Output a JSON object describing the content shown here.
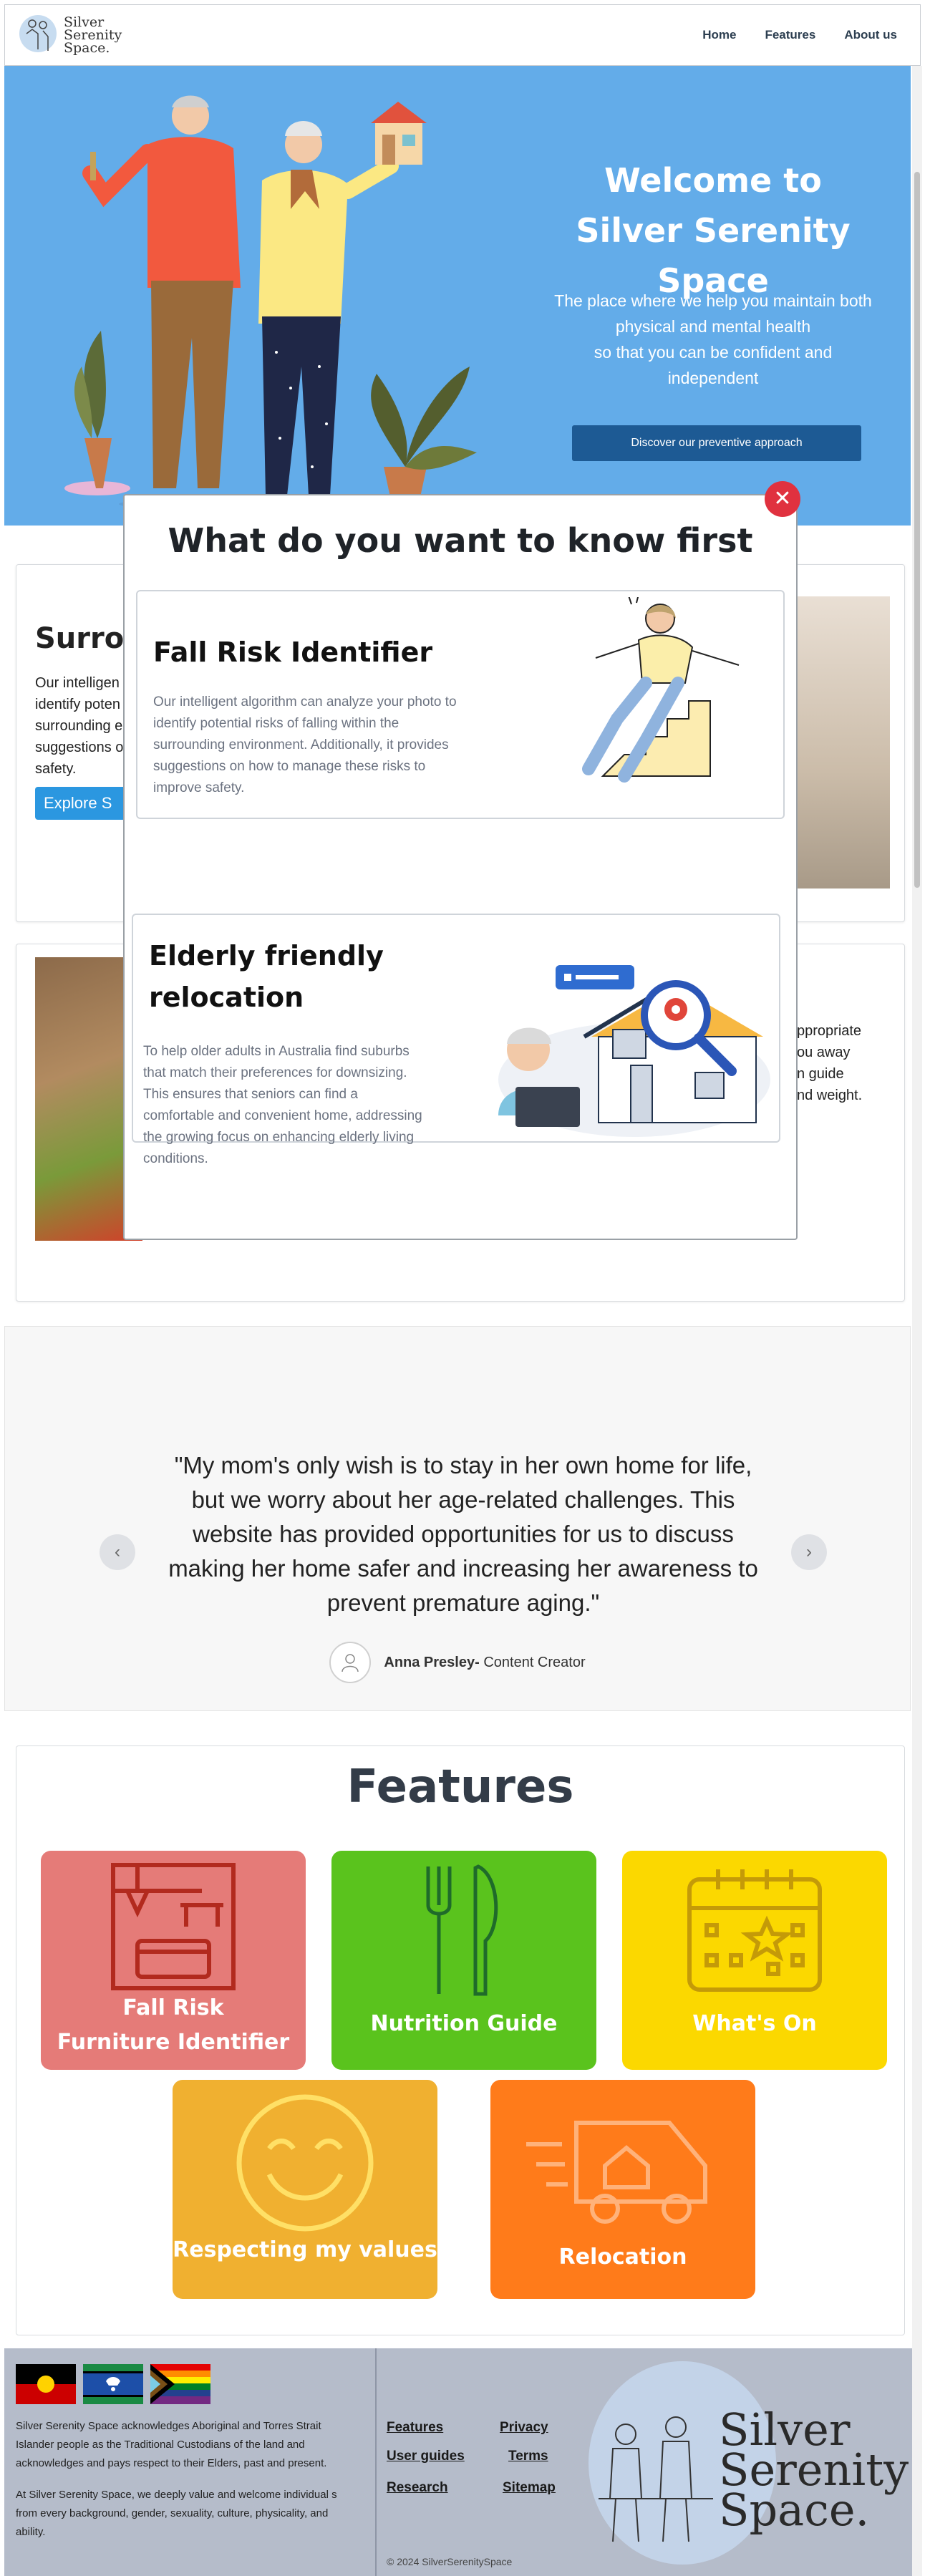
{
  "header": {
    "logo_text_1": "Silver",
    "logo_text_2": "Serenity",
    "logo_text_3": "Space.",
    "nav": [
      "Home",
      "Features",
      "About us"
    ]
  },
  "hero": {
    "title_line1": "Welcome to",
    "title_line2": "Silver Serenity Space",
    "subtitle_line1": "The place where we help you maintain both",
    "subtitle_line2": "physical and mental health",
    "subtitle_line3": "so that you can be confident and",
    "subtitle_line4": "independent",
    "button": "Discover our preventive approach",
    "bg_color": "#63ace9"
  },
  "background_sections": {
    "s1_title": "Surrou",
    "s1_text": [
      "Our intelligen",
      "identify poten",
      "surrounding e",
      "suggestions o",
      "safety."
    ],
    "s1_button": "Explore S",
    "s2_text": [
      "ppropriate",
      "ou away",
      "n guide",
      "nd weight."
    ]
  },
  "modal": {
    "title": "What do you want to know first",
    "close": "✕",
    "option1": {
      "title": "Fall Risk Identifier",
      "desc": [
        "Our intelligent algorithm can analyze your photo to",
        "identify potential risks of falling within the",
        "surrounding environment. Additionally, it provides",
        "suggestions on how to manage these risks to",
        "improve safety."
      ]
    },
    "option2": {
      "title_line1": "Elderly friendly",
      "title_line2": "relocation",
      "desc": [
        "To help older adults in Australia find suburbs",
        "that match their preferences for downsizing.",
        "This ensures that seniors can find a",
        "comfortable and convenient home, addressing",
        "the growing focus on enhancing elderly living",
        "conditions."
      ]
    }
  },
  "testimonial": {
    "quote": [
      "\"My mom's only wish is to stay in her own home for life,",
      "but we worry about her age-related challenges. This",
      "website has provided opportunities for us to discuss",
      "making her home safer and increasing her awareness to",
      "prevent premature aging.\""
    ],
    "author_name": "Anna Presley-",
    "author_role": " Content Creator",
    "prev": "‹",
    "next": "›"
  },
  "features": {
    "title": "Features",
    "tiles": [
      {
        "label_line1": "Fall Risk",
        "label_line2": "Furniture Identifier",
        "color": "#e57b78",
        "icon": "furniture-icon"
      },
      {
        "label_line1": "Nutrition Guide",
        "color": "#5ac31d",
        "icon": "cutlery-icon"
      },
      {
        "label_line1": "What's On",
        "color": "#fbd800",
        "icon": "calendar-icon"
      },
      {
        "label_line1": "Respecting my values",
        "color": "#f0b030",
        "icon": "smiley-icon"
      },
      {
        "label_line1": "Relocation",
        "color": "#ff7b1a",
        "icon": "moving-truck-icon"
      }
    ]
  },
  "footer": {
    "ack1": [
      "Silver Serenity Space acknowledges Aboriginal and Torres Strait",
      "Islander people as the Traditional Custodians of the land  and",
      "acknowledges and pays respect to their Elders, past and present."
    ],
    "ack2": [
      "At Silver Serenity Space, we deeply value and welcome individual s",
      "from every background, gender, sexuality, culture, physicality, and",
      "ability."
    ],
    "links_col1": [
      "Features",
      "User guides",
      "Research"
    ],
    "links_col2": [
      "Privacy",
      "Terms",
      "Sitemap"
    ],
    "copyright": "© 2024 SilverSerenitySpace",
    "logo_text_1": "Silver",
    "logo_text_2": "Serenity",
    "logo_text_3": "Space."
  }
}
